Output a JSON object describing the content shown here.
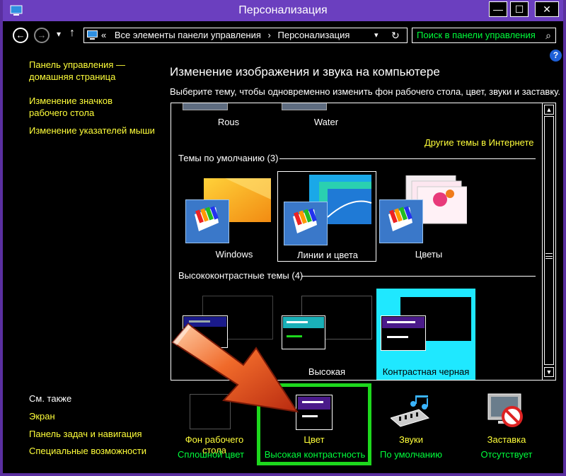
{
  "window": {
    "title": "Персонализация",
    "minimize_glyph": "—",
    "maximize_glyph": "☐",
    "close_glyph": "✕"
  },
  "nav": {
    "back_glyph": "←",
    "forward_glyph": "→",
    "up_glyph": "↑",
    "dropdown_glyph": "▾",
    "address_sep": "«",
    "address_crumb_1": "Все элементы панели управления",
    "address_arrow": "›",
    "address_crumb_2": "Персонализация",
    "refresh_glyph": "↻",
    "search_placeholder": "Поиск в панели управления",
    "search_glyph": "⌕"
  },
  "help_glyph": "?",
  "sidebar": {
    "home_link": "Панель управления — домашняя страница",
    "desktop_icons_link": "Изменение значков рабочего стола",
    "mouse_pointers_link": "Изменение указателей мыши",
    "see_also": "См. также",
    "see_also_links": [
      "Экран",
      "Панель задач и навигация",
      "Специальные возможности"
    ]
  },
  "main": {
    "title": "Изменение изображения и звука на компьютере",
    "subtitle": "Выберите тему, чтобы одновременно изменить фон рабочего стола, цвет, звуки и заставку."
  },
  "themes": {
    "top_row": [
      "Rous",
      "Water"
    ],
    "online_link": "Другие темы в Интернете",
    "default_header": "Темы по умолчанию (3)",
    "default_themes": [
      "Windows",
      "Линии и цвета",
      "Цветы"
    ],
    "hc_header": "Высококонтрастные темы (4)",
    "hc_themes": [
      "Высокая",
      "Контрастная черная"
    ]
  },
  "bottom": {
    "items": [
      {
        "label": "Фон рабочего стола",
        "sub": "Сплошной цвет"
      },
      {
        "label": "Цвет",
        "sub": "Высокая контрастность"
      },
      {
        "label": "Звуки",
        "sub": "По умолчанию"
      },
      {
        "label": "Заставка",
        "sub": "Отсутствует"
      }
    ]
  },
  "colors": {
    "titlebar": "#6b3fbf",
    "link_yellow": "#ffff3a",
    "value_green": "#00ff3c",
    "selection_cyan": "#1fe8ff",
    "highlight_green": "#1dd81d",
    "arrow_orange": "#e8501e"
  }
}
